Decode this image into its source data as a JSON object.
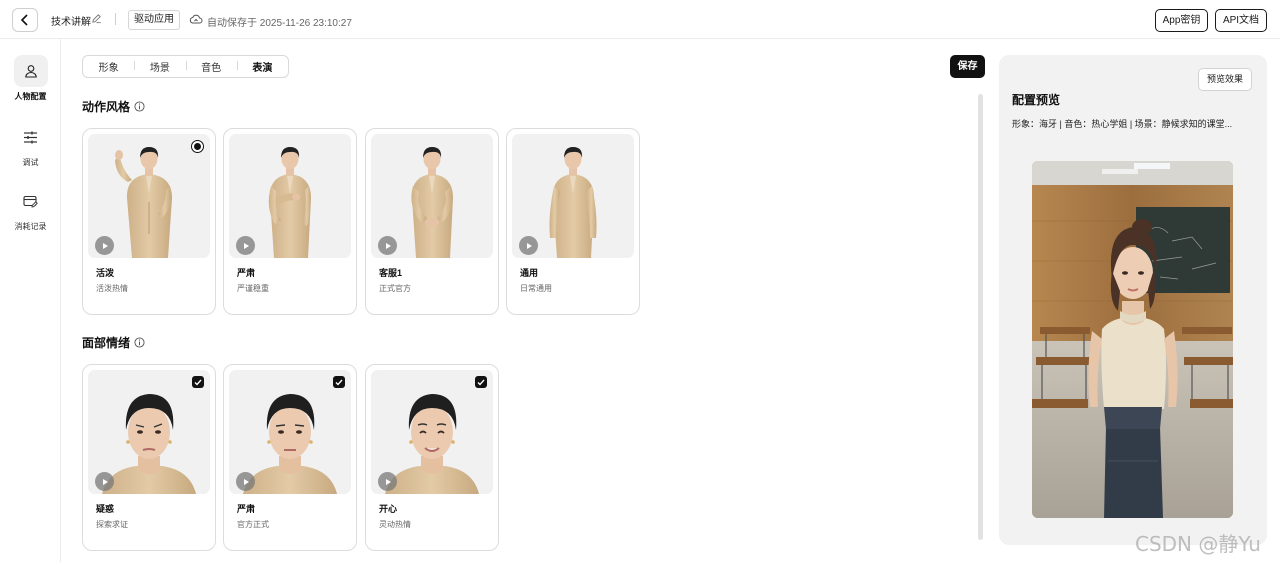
{
  "header": {
    "app_name": "技术讲解",
    "tag": "驱动应用",
    "autosave": "自动保存于 2025-11-26 23:10:27",
    "app_key_label": "App密钥",
    "api_doc_label": "API文档"
  },
  "sidebar": {
    "items": [
      {
        "label": "人物配置",
        "icon": "person-icon",
        "active": true
      },
      {
        "label": "调试",
        "icon": "sliders-icon",
        "active": false
      },
      {
        "label": "消耗记录",
        "icon": "card-edit-icon",
        "active": false
      }
    ]
  },
  "tabs": [
    {
      "label": "形象",
      "active": false
    },
    {
      "label": "场景",
      "active": false
    },
    {
      "label": "音色",
      "active": false
    },
    {
      "label": "表演",
      "active": true
    }
  ],
  "save_label": "保存",
  "motion": {
    "title": "动作风格",
    "cards": [
      {
        "name": "活泼",
        "desc": "活泼热情",
        "selected": true
      },
      {
        "name": "严肃",
        "desc": "严谨稳重",
        "selected": false
      },
      {
        "name": "客服1",
        "desc": "正式官方",
        "selected": false
      },
      {
        "name": "通用",
        "desc": "日常通用",
        "selected": false
      }
    ]
  },
  "emotion": {
    "title": "面部情绪",
    "cards": [
      {
        "name": "疑惑",
        "desc": "探索求证",
        "checked": true
      },
      {
        "name": "严肃",
        "desc": "官方正式",
        "checked": true
      },
      {
        "name": "开心",
        "desc": "灵动热情",
        "checked": true
      }
    ]
  },
  "preview": {
    "button": "预览效果",
    "title": "配置预览",
    "info": "形象：海牙 | 音色：热心学姐 | 场景：静候求知的课堂..."
  },
  "watermark": "CSDN @静Yu",
  "colors": {
    "accent": "#111111",
    "suit": "#d9bf97",
    "board": "#2f3a36"
  }
}
